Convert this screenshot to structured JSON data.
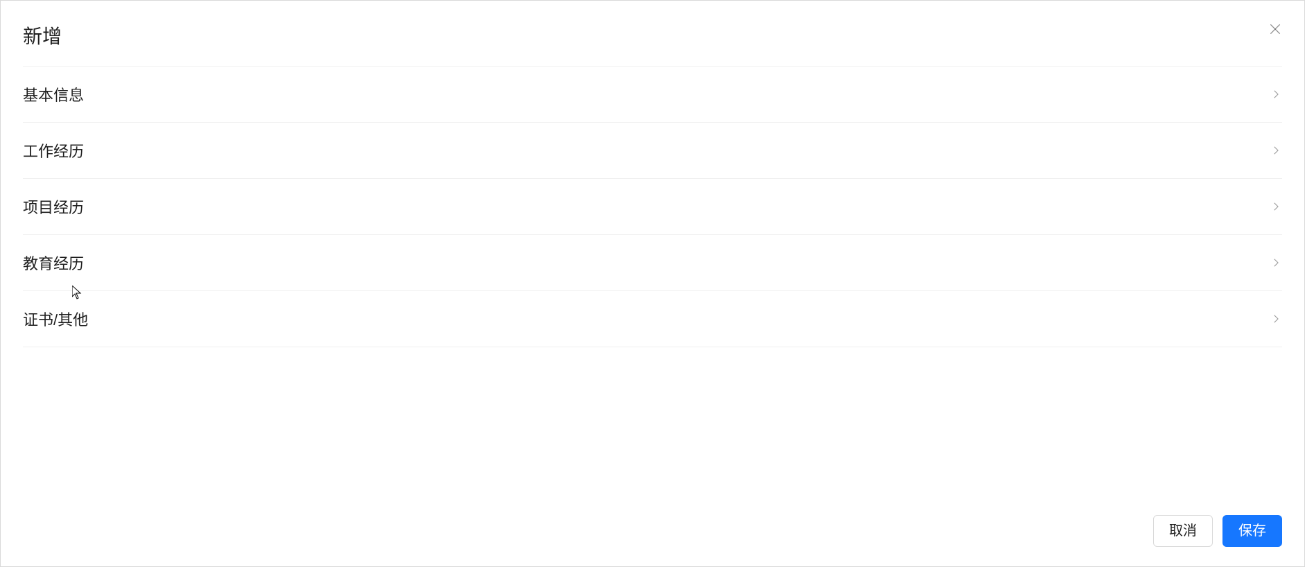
{
  "modal": {
    "title": "新增",
    "sections": [
      {
        "label": "基本信息"
      },
      {
        "label": "工作经历"
      },
      {
        "label": "项目经历"
      },
      {
        "label": "教育经历"
      },
      {
        "label": "证书/其他"
      }
    ],
    "footer": {
      "cancel_label": "取消",
      "save_label": "保存"
    }
  }
}
